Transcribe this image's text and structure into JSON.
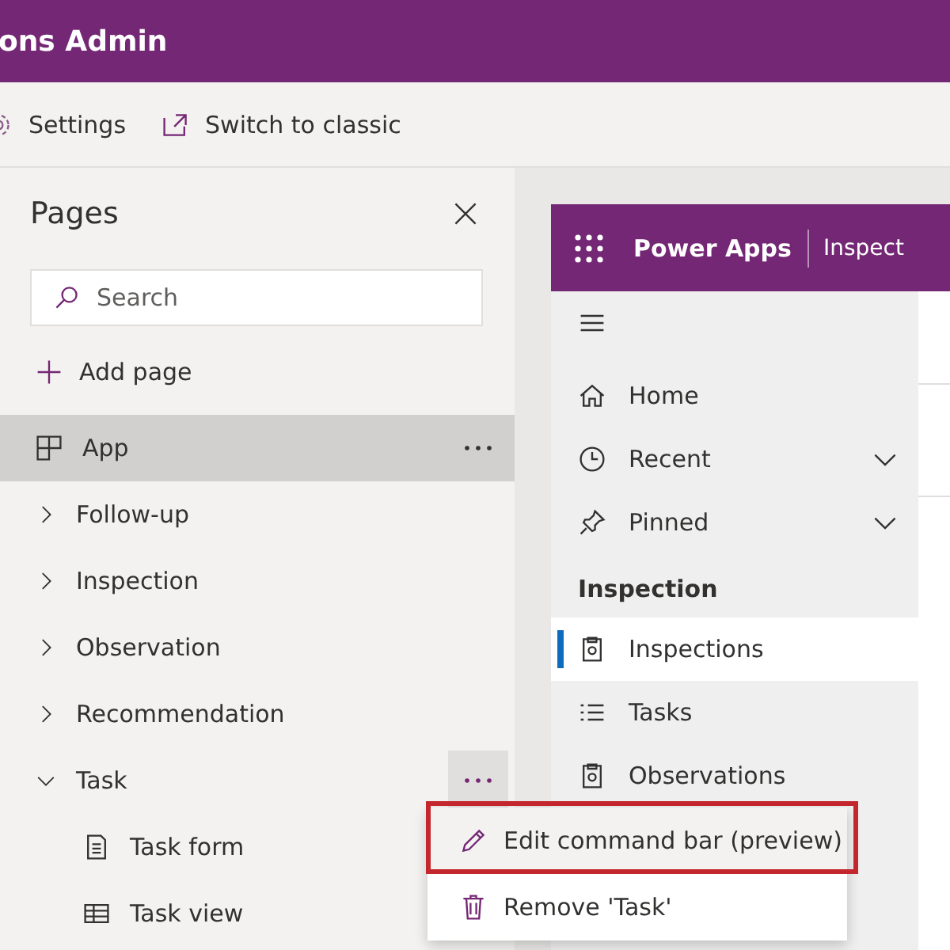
{
  "header": {
    "title": "ons Admin"
  },
  "toolbar": [
    {
      "label": "Settings",
      "kind": "settings"
    },
    {
      "label": "Switch to classic",
      "kind": "switch"
    }
  ],
  "pages_panel": {
    "title": "Pages",
    "search": {
      "placeholder": "Search"
    },
    "add_label": "Add page",
    "items": [
      {
        "label": "App",
        "kind": "app",
        "selected": true,
        "menu_open": false
      },
      {
        "label": "Follow-up",
        "selected": false,
        "menu_open": false,
        "expanded": false
      },
      {
        "label": "Inspection",
        "selected": false,
        "menu_open": false,
        "expanded": false
      },
      {
        "label": "Observation",
        "selected": false,
        "menu_open": false,
        "expanded": false
      },
      {
        "label": "Recommendation",
        "selected": false,
        "menu_open": false,
        "expanded": false
      },
      {
        "label": "Task",
        "selected": false,
        "menu_open": true,
        "expanded": true,
        "children": [
          {
            "label": "Task form",
            "kind": "form"
          },
          {
            "label": "Task view",
            "kind": "view"
          }
        ]
      }
    ]
  },
  "context_menu": [
    {
      "label": "Edit command bar (preview)",
      "kind": "edit",
      "selected": true,
      "annotated": true
    },
    {
      "label": "Remove 'Task'",
      "kind": "remove",
      "selected": false,
      "annotated": false
    }
  ],
  "preview": {
    "app_name": "Power Apps",
    "app_title": "Inspect",
    "nav": [
      {
        "label": "Home",
        "kind": "home",
        "expandable": false
      },
      {
        "label": "Recent",
        "kind": "recent",
        "expandable": true
      },
      {
        "label": "Pinned",
        "kind": "pinned",
        "expandable": true
      }
    ],
    "section": "Inspection",
    "section_items": [
      {
        "label": "Inspections",
        "kind": "record",
        "selected": true
      },
      {
        "label": "Tasks",
        "kind": "list",
        "selected": false
      },
      {
        "label": "Observations",
        "kind": "record",
        "selected": false
      }
    ]
  }
}
